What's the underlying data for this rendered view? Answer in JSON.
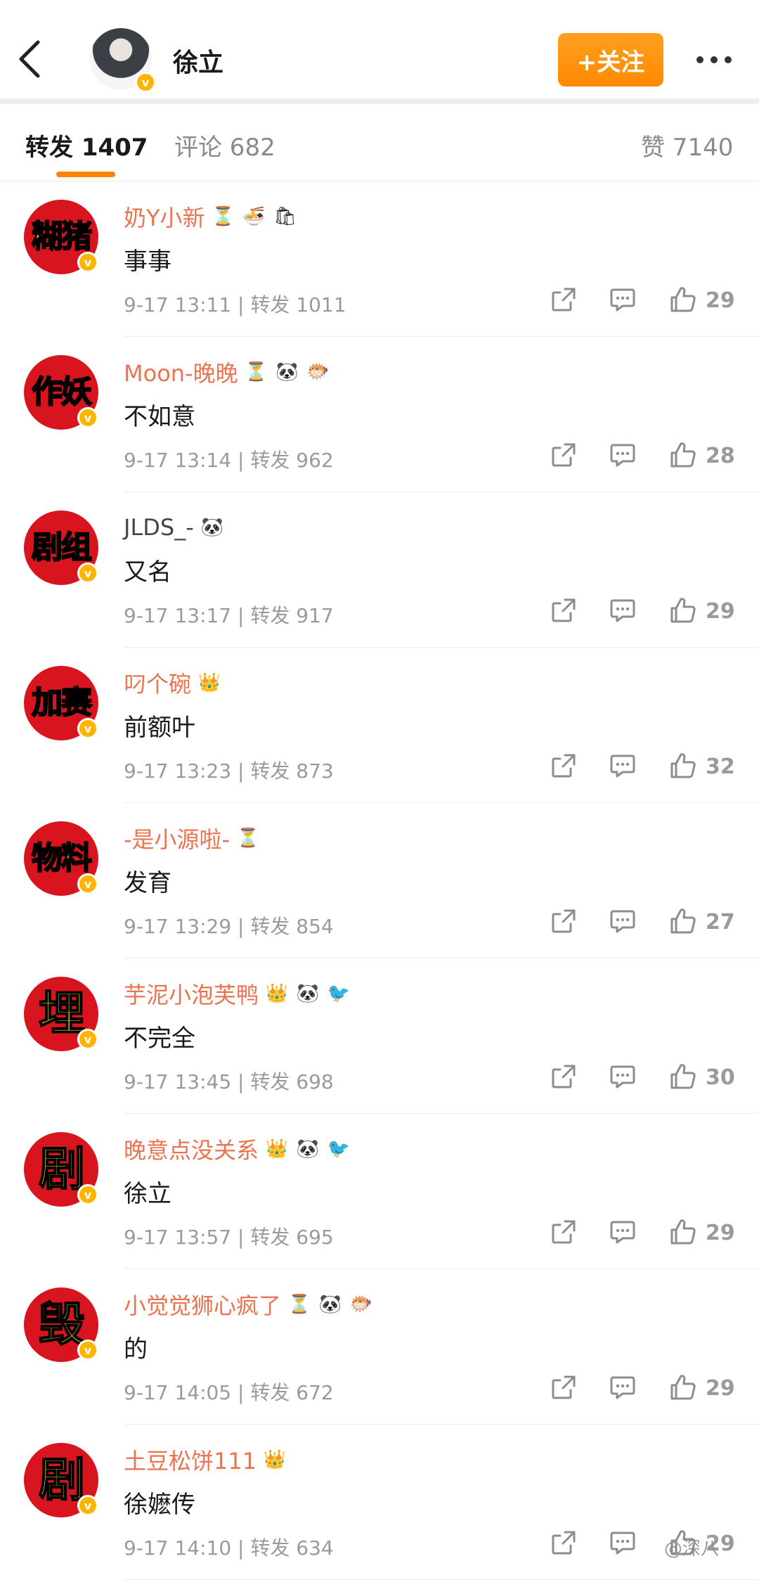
{
  "header": {
    "name": "徐立",
    "follow_label": "+关注"
  },
  "tabs": {
    "repost": "转发 1407",
    "comment": "评论 682",
    "likes": "赞 7140"
  },
  "comments": [
    {
      "avatar_text": "糊猪",
      "username": "奶Y小新",
      "emojis": [
        "⏳",
        "🍜",
        "🛍"
      ],
      "content": "事事",
      "meta": "9-17 13:11 | 转发 1011",
      "likes": "29",
      "name_color": "orange"
    },
    {
      "avatar_text": "作妖",
      "username": "Moon-晚晚",
      "emojis": [
        "⏳",
        "🐼",
        "🐡"
      ],
      "content": "不如意",
      "meta": "9-17 13:14 | 转发 962",
      "likes": "28",
      "name_color": "orange"
    },
    {
      "avatar_text": "剧组",
      "username": "JLDS_-",
      "emojis": [
        "🐼"
      ],
      "content": "又名",
      "meta": "9-17 13:17 | 转发 917",
      "likes": "29",
      "name_color": "gray"
    },
    {
      "avatar_text": "加赛",
      "username": "叼个碗",
      "emojis": [
        "👑"
      ],
      "content": "前额叶",
      "meta": "9-17 13:23 | 转发 873",
      "likes": "32",
      "name_color": "orange"
    },
    {
      "avatar_text": "物料",
      "username": "-是小源啦-",
      "emojis": [
        "⏳"
      ],
      "content": "发育",
      "meta": "9-17 13:29 | 转发 854",
      "likes": "27",
      "name_color": "orange"
    },
    {
      "avatar_text": "埋",
      "username": "芋泥小泡芙鸭",
      "emojis": [
        "👑",
        "🐼",
        "🐦"
      ],
      "content": "不完全",
      "meta": "9-17 13:45 | 转发 698",
      "likes": "30",
      "name_color": "orange"
    },
    {
      "avatar_text": "剧",
      "username": "晚意点没关系",
      "emojis": [
        "👑",
        "🐼",
        "🐦"
      ],
      "content": "徐立",
      "meta": "9-17 13:57 | 转发 695",
      "likes": "29",
      "name_color": "orange"
    },
    {
      "avatar_text": "毁",
      "username": "小觉觉狮心疯了",
      "emojis": [
        "⏳",
        "🐼",
        "🐡"
      ],
      "content": "的",
      "meta": "9-17 14:05 | 转发 672",
      "likes": "29",
      "name_color": "orange"
    },
    {
      "avatar_text": "剧",
      "username": "土豆松饼111",
      "emojis": [
        "👑"
      ],
      "content": "徐嬷传",
      "meta": "9-17 14:10 | 转发 634",
      "likes": "29",
      "name_color": "orange"
    }
  ],
  "watermark": "@深八",
  "colors": {
    "accent": "#ff8200",
    "username": "#eb7350",
    "avatar_bg": "#d8141e",
    "avatar_text": "#ffe51c"
  }
}
